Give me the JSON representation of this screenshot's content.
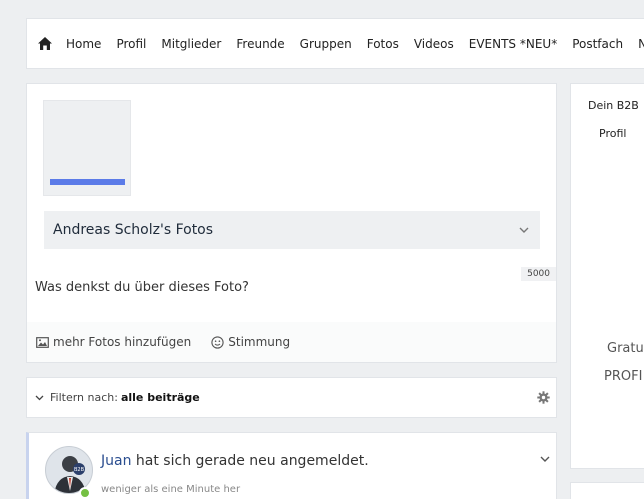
{
  "nav": {
    "items": [
      "Home",
      "Profil",
      "Mitglieder",
      "Freunde",
      "Gruppen",
      "Fotos",
      "Videos",
      "EVENTS *NEU*",
      "Postfach",
      "Ne"
    ]
  },
  "upload": {
    "album_title": "Andreas Scholz's Fotos",
    "char_limit": "5000",
    "placeholder": "Was denkst du über dieses Foto?",
    "add_photos_label": "mehr Fotos hinzufügen",
    "mood_label": "Stimmung"
  },
  "filter": {
    "label": "Filtern nach:",
    "value": "alle beiträge"
  },
  "feed": {
    "name": "Juan",
    "message": " hat sich gerade neu angemeldet.",
    "time": "weniger als eine Minute her",
    "avatar_badge": "B2B"
  },
  "sidebar": {
    "title": "Dein B2B",
    "subtitle": "Profil",
    "line1": "Gratu",
    "line2": "PROFI"
  },
  "colors": {
    "accent": "#5b7be8",
    "online": "#75c043",
    "link": "#2a4d8f"
  }
}
